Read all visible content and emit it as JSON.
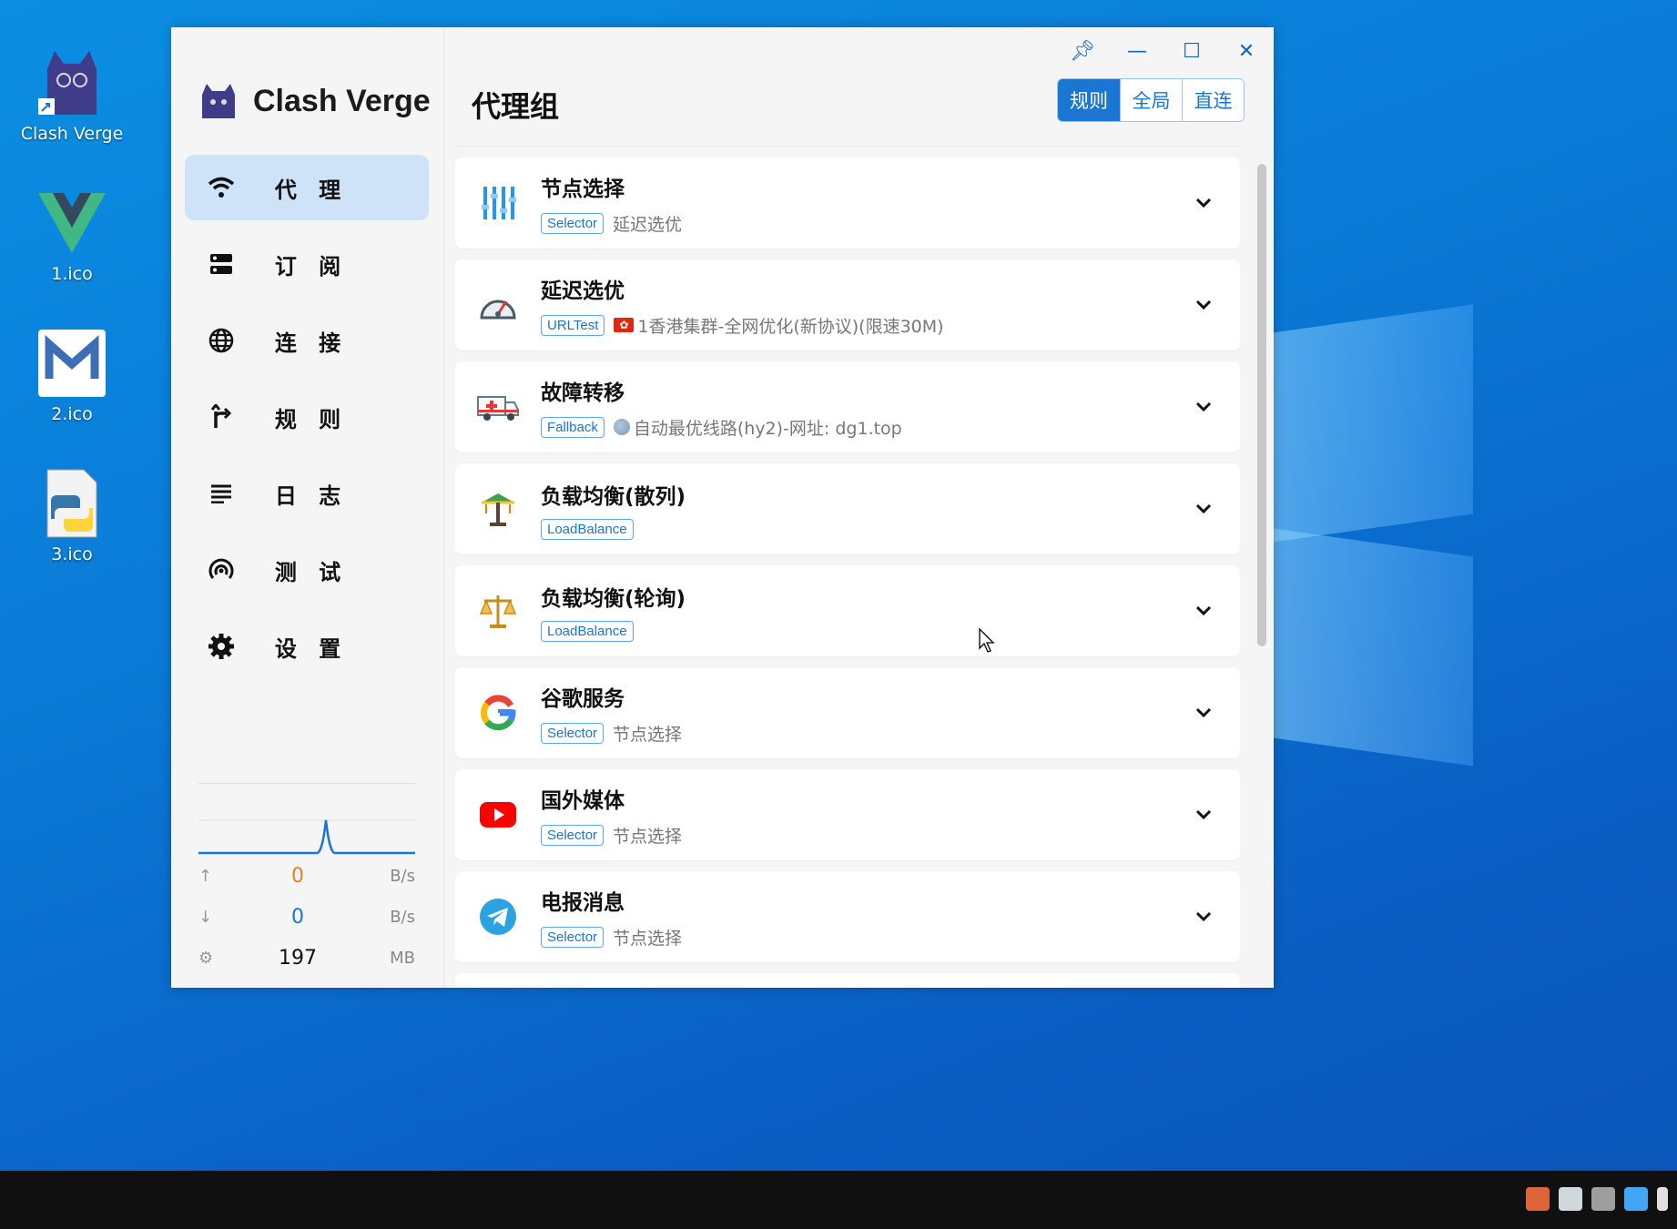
{
  "desktop": {
    "icons": [
      {
        "label": "Clash Verge"
      },
      {
        "label": "1.ico"
      },
      {
        "label": "2.ico"
      },
      {
        "label": "3.ico"
      }
    ]
  },
  "app": {
    "name": "Clash Verge",
    "nav": [
      {
        "label": "代 理",
        "icon": "wifi-icon",
        "active": true
      },
      {
        "label": "订 阅",
        "icon": "server-icon"
      },
      {
        "label": "连 接",
        "icon": "globe-icon"
      },
      {
        "label": "规 则",
        "icon": "route-icon"
      },
      {
        "label": "日 志",
        "icon": "list-icon"
      },
      {
        "label": "测 试",
        "icon": "radar-icon"
      },
      {
        "label": "设 置",
        "icon": "gear-icon"
      }
    ],
    "traffic": {
      "up": {
        "value": "0",
        "unit": "B/s"
      },
      "down": {
        "value": "0",
        "unit": "B/s"
      },
      "memory": {
        "value": "197",
        "unit": "MB"
      }
    },
    "page_title": "代理组",
    "modes": [
      {
        "label": "规则",
        "on": true
      },
      {
        "label": "全局"
      },
      {
        "label": "直连"
      }
    ],
    "groups": [
      {
        "name": "节点选择",
        "type": "Selector",
        "now": "延迟选优",
        "icon": "sliders-icon"
      },
      {
        "name": "延迟选优",
        "type": "URLTest",
        "now": "1香港集群-全网优化(新协议)(限速30M)",
        "icon": "speedometer-icon",
        "flag": "hk"
      },
      {
        "name": "故障转移",
        "type": "Fallback",
        "now": "自动最优线路(hy2)-网址: dg1.top",
        "icon": "ambulance-icon",
        "flag": "globe"
      },
      {
        "name": "负载均衡(散列)",
        "type": "LoadBalance",
        "now": "",
        "icon": "carousel-icon"
      },
      {
        "name": "负载均衡(轮询)",
        "type": "LoadBalance",
        "now": "",
        "icon": "scales-icon"
      },
      {
        "name": "谷歌服务",
        "type": "Selector",
        "now": "节点选择",
        "icon": "google-icon"
      },
      {
        "name": "国外媒体",
        "type": "Selector",
        "now": "节点选择",
        "icon": "youtube-icon"
      },
      {
        "name": "电报消息",
        "type": "Selector",
        "now": "节点选择",
        "icon": "telegram-icon"
      }
    ]
  },
  "colors": {
    "accent": "#1976d2",
    "active_nav": "#cfe3f8",
    "upload": "#e67e22"
  }
}
